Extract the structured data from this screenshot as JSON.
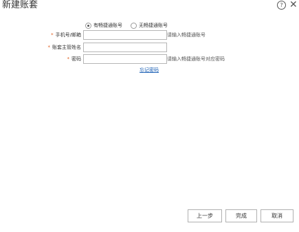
{
  "dialog": {
    "title": "新建账套"
  },
  "header_icons": {
    "help": "help-icon",
    "close": "close-icon",
    "help_glyph": "?",
    "close_glyph": "✕"
  },
  "account_type": {
    "options": [
      {
        "label": "有畅捷通账号",
        "selected": true
      },
      {
        "label": "无畅捷通账号",
        "selected": false
      }
    ]
  },
  "form": {
    "required_mark": "*",
    "phone_email": {
      "label": "手机号/邮箱",
      "value": "",
      "hint": "请输入畅捷通账号"
    },
    "manager_name": {
      "label": "账套主管姓名",
      "value": ""
    },
    "password": {
      "label": "密码",
      "value": "",
      "hint": "请输入畅捷通账号对应密码"
    },
    "forgot_password": "忘记密码"
  },
  "footer": {
    "prev_label": "上一步",
    "finish_label": "完成",
    "cancel_label": "取消"
  },
  "colors": {
    "required": "#e05a1a",
    "link": "#1a5fb4",
    "border": "#b5b5b5"
  }
}
